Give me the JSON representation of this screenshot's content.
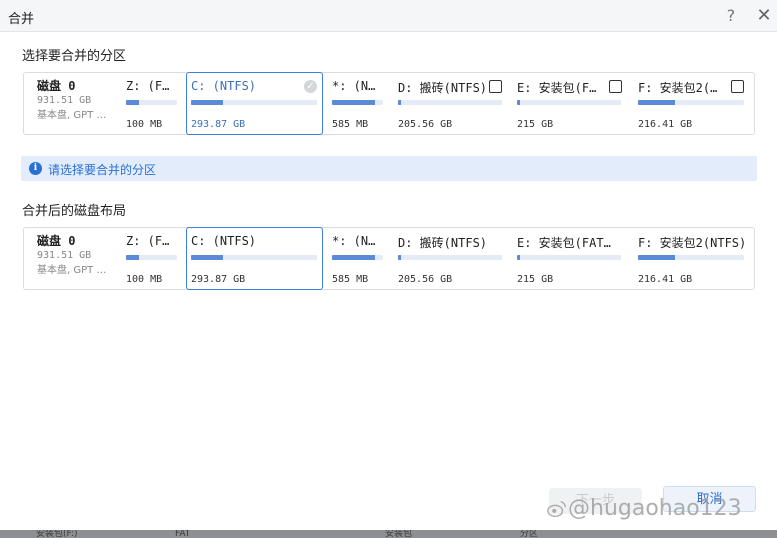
{
  "window": {
    "title": "合并",
    "help_icon": "?",
    "close_icon": "✕"
  },
  "select_section": {
    "label": "选择要合并的分区",
    "disk": {
      "name": "磁盘 0",
      "size": "931.51 GB",
      "type": "基本盘, GPT …"
    },
    "partitions": [
      {
        "label": "Z: (F…",
        "size": "100 MB",
        "used_fraction": 0.25,
        "checkbox": false
      },
      {
        "label": "C: (NTFS)",
        "size": "293.87 GB",
        "used_fraction": 0.25,
        "checkbox": true,
        "checked": true,
        "selected": true
      },
      {
        "label": "*: (N…",
        "size": "585 MB",
        "used_fraction": 0.85,
        "checkbox": false
      },
      {
        "label": "D: 搬砖(NTFS)",
        "size": "205.56 GB",
        "used_fraction": 0.02,
        "checkbox": true,
        "checked": false
      },
      {
        "label": "E: 安装包(F…",
        "size": "215 GB",
        "used_fraction": 0.02,
        "checkbox": true,
        "checked": false
      },
      {
        "label": "F: 安装包2(…",
        "size": "216.41 GB",
        "used_fraction": 0.35,
        "checkbox": true,
        "checked": false
      }
    ]
  },
  "info_message": "请选择要合并的分区",
  "result_section": {
    "label": "合并后的磁盘布局",
    "disk": {
      "name": "磁盘 0",
      "size": "931.51 GB",
      "type": "基本盘, GPT …"
    },
    "partitions": [
      {
        "label": "Z: (F…",
        "size": "100 MB",
        "used_fraction": 0.25
      },
      {
        "label": "C: (NTFS)",
        "size": "293.87 GB",
        "used_fraction": 0.25,
        "selected": true
      },
      {
        "label": "*: (N…",
        "size": "585 MB",
        "used_fraction": 0.85
      },
      {
        "label": "D: 搬砖(NTFS)",
        "size": "205.56 GB",
        "used_fraction": 0.02
      },
      {
        "label": "E: 安装包(FAT…",
        "size": "215 GB",
        "used_fraction": 0.02
      },
      {
        "label": "F: 安装包2(NTFS)",
        "size": "216.41 GB",
        "used_fraction": 0.35
      }
    ]
  },
  "buttons": {
    "next": "下一步",
    "cancel": "取消"
  },
  "watermark": "@hugaohao123",
  "taskbar": {
    "items": [
      "安装包(F:)",
      "FAT",
      "安装包",
      "分区"
    ]
  },
  "colors": {
    "accent": "#2a6fd6",
    "bar_fill": "#5b8ad6",
    "bar_track": "#e4ebf6",
    "info_bg": "#e3ecfa"
  }
}
